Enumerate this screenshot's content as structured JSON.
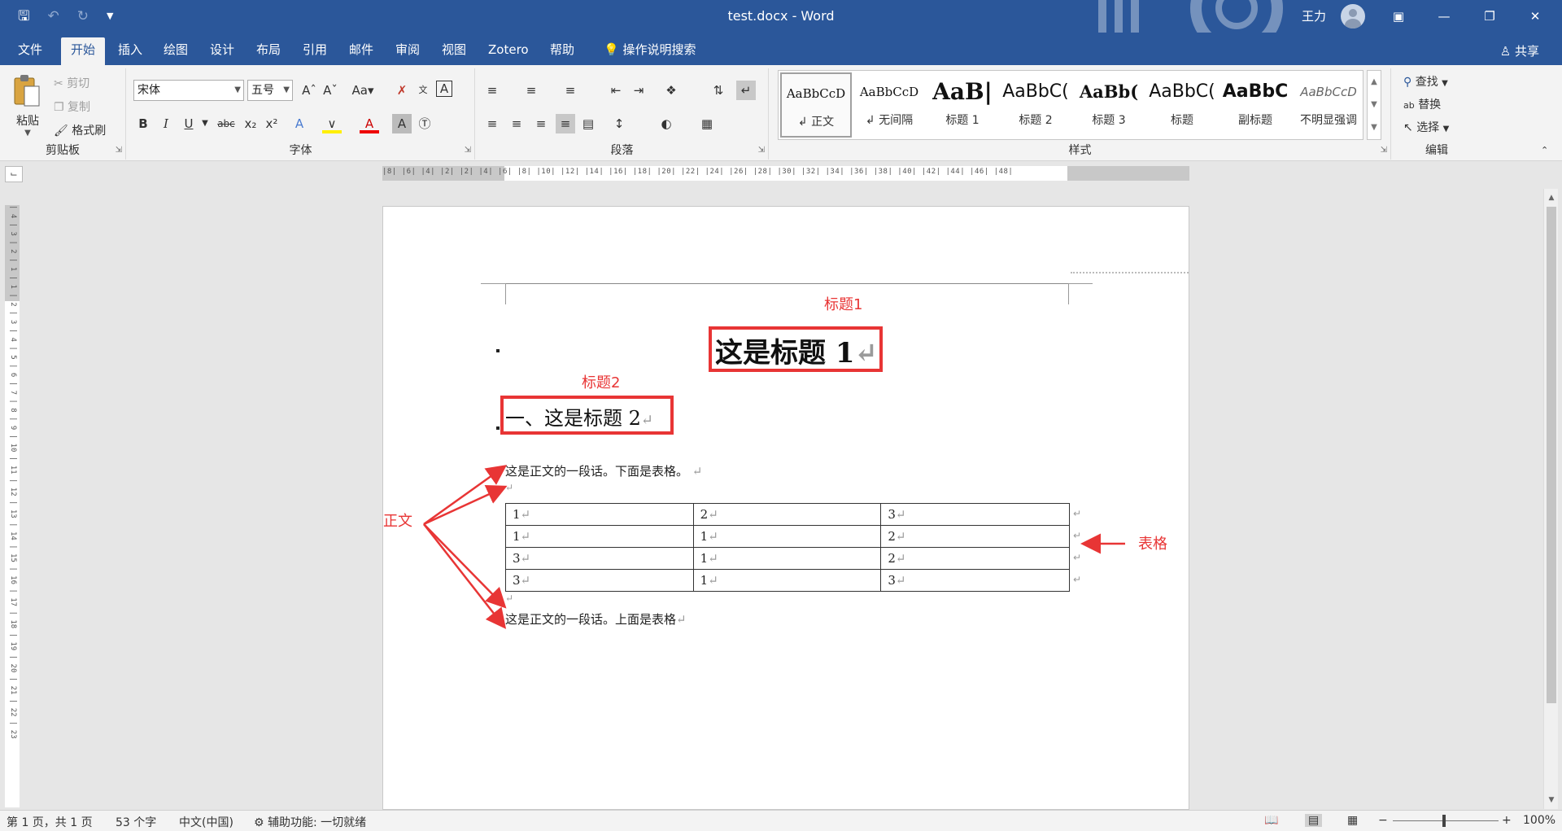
{
  "window": {
    "title": "test.docx - Word",
    "user_name": "王力"
  },
  "qat": {
    "save_icon": "save-icon",
    "undo_icon": "undo-icon",
    "redo_icon": "redo-icon",
    "customize_icon": "chevron-down-icon"
  },
  "tabs": [
    {
      "label": "文件"
    },
    {
      "label": "开始"
    },
    {
      "label": "插入"
    },
    {
      "label": "绘图"
    },
    {
      "label": "设计"
    },
    {
      "label": "布局"
    },
    {
      "label": "引用"
    },
    {
      "label": "邮件"
    },
    {
      "label": "审阅"
    },
    {
      "label": "视图"
    },
    {
      "label": "Zotero"
    },
    {
      "label": "帮助"
    }
  ],
  "tell_me": "操作说明搜索",
  "share": "共享",
  "ribbon": {
    "clipboard": {
      "label": "剪贴板",
      "paste": "粘贴",
      "cut": "剪切",
      "copy": "复制",
      "format_painter": "格式刷"
    },
    "font": {
      "label": "字体",
      "font_name": "宋体",
      "font_size": "五号"
    },
    "paragraph": {
      "label": "段落"
    },
    "styles": {
      "label": "样式",
      "items": [
        {
          "sample": "AaBbCcD",
          "name": "↲ 正文"
        },
        {
          "sample": "AaBbCcD",
          "name": "↲ 无间隔"
        },
        {
          "sample": "AaB|",
          "name": "标题 1"
        },
        {
          "sample": "AaBbC(",
          "name": "标题 2"
        },
        {
          "sample": "AaBb(",
          "name": "标题 3"
        },
        {
          "sample": "AaBbC(",
          "name": "标题"
        },
        {
          "sample": "AaBbC",
          "name": "副标题"
        },
        {
          "sample": "AaBbCcD",
          "name": "不明显强调"
        }
      ]
    },
    "editing": {
      "label": "编辑",
      "find": "查找",
      "replace": "替换",
      "select": "选择"
    }
  },
  "document": {
    "heading1": "这是标题 1",
    "heading2": "一、这是标题 2",
    "para1": "这是正文的一段话。下面是表格。",
    "para2": "这是正文的一段话。上面是表格",
    "paragraph_mark": "↵",
    "table": [
      [
        "1",
        "2",
        "3"
      ],
      [
        "1",
        "1",
        "2"
      ],
      [
        "3",
        "1",
        "2"
      ],
      [
        "3",
        "1",
        "3"
      ]
    ]
  },
  "annotations": {
    "heading1": "标题1",
    "heading2": "标题2",
    "body": "正文",
    "table": "表格",
    "color": "#e83535"
  },
  "statusbar": {
    "page": "第 1 页，共 1 页",
    "words": "53 个字",
    "language": "中文(中国)",
    "accessibility": "辅助功能: 一切就绪",
    "zoom": "100%"
  },
  "colors": {
    "title_bar": "#2b579a",
    "ribbon": "#f3f3f3"
  }
}
